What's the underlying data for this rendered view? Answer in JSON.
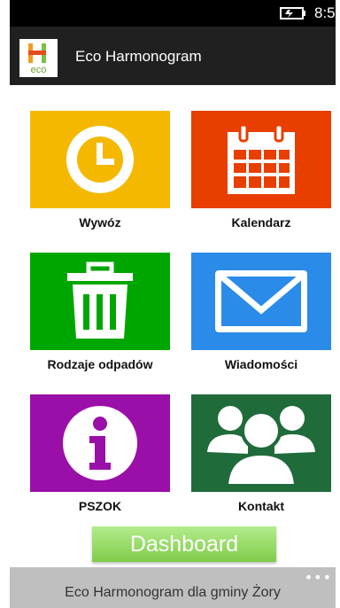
{
  "status_bar": {
    "time": "8:5"
  },
  "header": {
    "title": "Eco Harmonogram",
    "logo_text": "eco"
  },
  "tiles": [
    {
      "label": "Wywóz",
      "color": "#f5b800",
      "icon": "clock-icon"
    },
    {
      "label": "Kalendarz",
      "color": "#e83e00",
      "icon": "calendar-icon"
    },
    {
      "label": "Rodzaje odpadów",
      "color": "#00a600",
      "icon": "trash-icon"
    },
    {
      "label": "Wiadomości",
      "color": "#2a8be8",
      "icon": "envelope-icon"
    },
    {
      "label": "PSZOK",
      "color": "#9a0fa8",
      "icon": "info-icon"
    },
    {
      "label": "Kontakt",
      "color": "#206b3a",
      "icon": "people-icon"
    }
  ],
  "dashboard": {
    "label": "Dashboard"
  },
  "app_bar": {
    "text": "Eco Harmonogram dla gminy Żory",
    "more_label": "•••"
  }
}
